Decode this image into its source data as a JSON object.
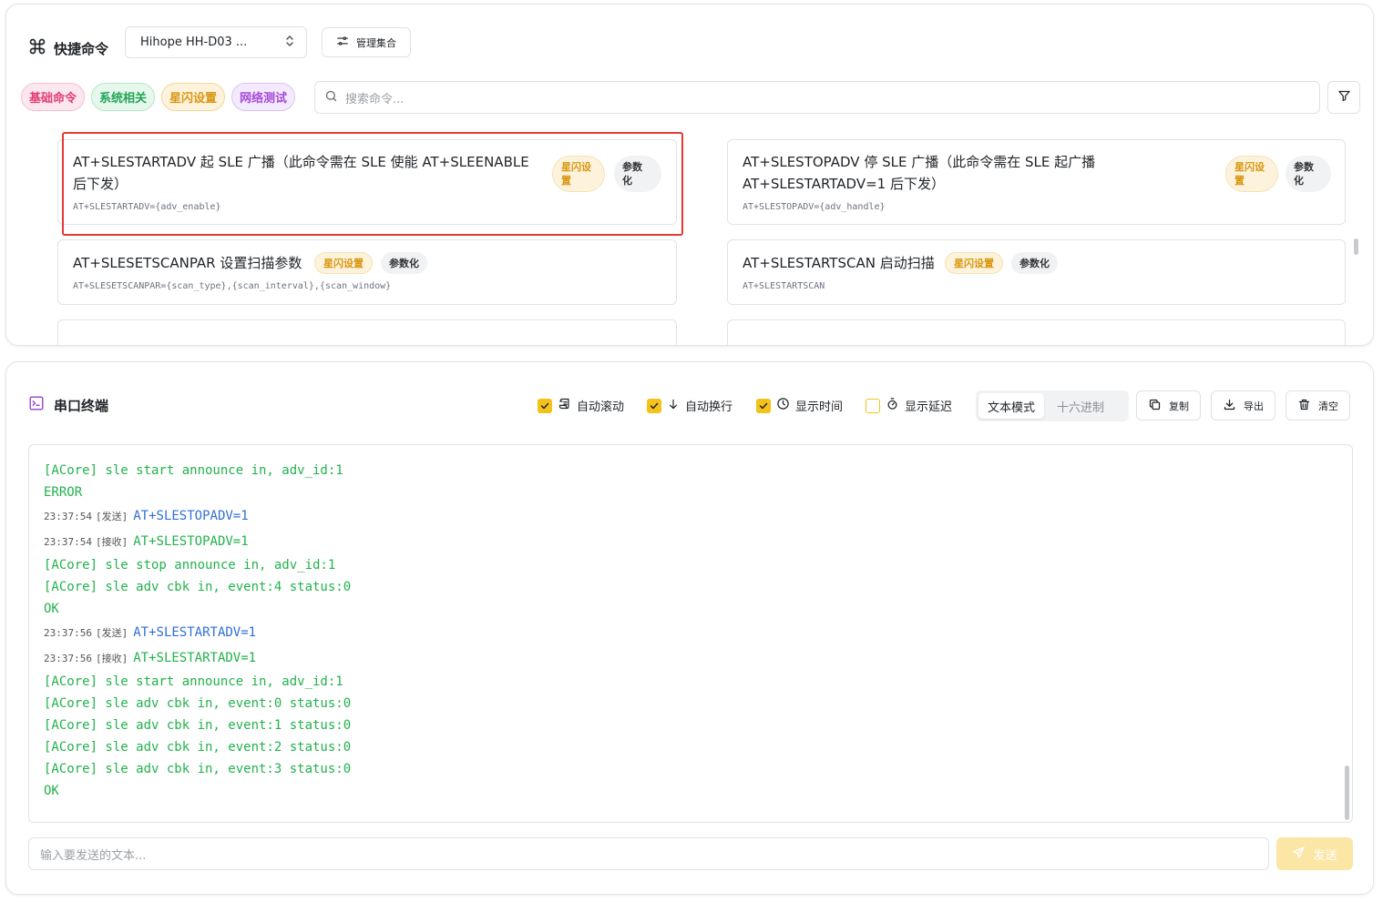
{
  "quick_commands": {
    "title": "快捷命令",
    "device_select": "Hihope HH-D03 ...",
    "manage_label": "管理集合",
    "tags": [
      "基础命令",
      "系统相关",
      "星闪设置",
      "网络测试"
    ],
    "search_placeholder": "搜索命令...",
    "cards": [
      {
        "name_line1": "AT+SLESTARTADV 起 SLE 广播（此命令需在 SLE 使能 AT+SLEENABLE",
        "name_line2": "后下发）",
        "command": "AT+SLESTARTADV={adv_enable}",
        "badge_category_line1": "星闪设",
        "badge_category_line2": "置",
        "badge_param_line1": "参数",
        "badge_param_line2": "化"
      },
      {
        "name_line1": "AT+SLESTOPADV 停 SLE 广播（此命令需在 SLE 起广播",
        "name_line2": "AT+SLESTARTADV=1 后下发）",
        "command": "AT+SLESTOPADV={adv_handle}",
        "badge_category_line1": "星闪设",
        "badge_category_line2": "置",
        "badge_param_line1": "参数",
        "badge_param_line2": "化"
      },
      {
        "name": "AT+SLESETSCANPAR 设置扫描参数",
        "command": "AT+SLESETSCANPAR={scan_type},{scan_interval},{scan_window}",
        "badge_category": "星闪设置",
        "badge_param": "参数化"
      },
      {
        "name": "AT+SLESTARTSCAN 启动扫描",
        "command": "AT+SLESTARTSCAN",
        "badge_category": "星闪设置",
        "badge_param": "参数化"
      }
    ]
  },
  "terminal": {
    "title": "串口终端",
    "options": {
      "auto_scroll": "自动滚动",
      "auto_wrap": "自动换行",
      "show_time": "显示时间",
      "show_delay": "显示延迟"
    },
    "modes": [
      "文本模式",
      "十六进制"
    ],
    "copy_label": "复制",
    "export_label": "导出",
    "clear_label": "清空",
    "log": [
      {
        "type": "plain",
        "text": "[ACore] sle start announce in, adv_id:1"
      },
      {
        "type": "plain",
        "text": "ERROR"
      },
      {
        "type": "meta",
        "time": "23:37:54",
        "dir": "[发送]",
        "kind": "sent",
        "text": "AT+SLESTOPADV=1"
      },
      {
        "type": "meta",
        "time": "23:37:54",
        "dir": "[接收]",
        "kind": "recv",
        "text": "AT+SLESTOPADV=1"
      },
      {
        "type": "plain",
        "text": "[ACore] sle stop announce in, adv_id:1"
      },
      {
        "type": "plain",
        "text": "[ACore] sle adv cbk in, event:4 status:0"
      },
      {
        "type": "plain",
        "text": "OK"
      },
      {
        "type": "meta",
        "time": "23:37:56",
        "dir": "[发送]",
        "kind": "sent",
        "text": "AT+SLESTARTADV=1"
      },
      {
        "type": "meta",
        "time": "23:37:56",
        "dir": "[接收]",
        "kind": "recv",
        "text": "AT+SLESTARTADV=1"
      },
      {
        "type": "plain",
        "text": "[ACore] sle start announce in, adv_id:1"
      },
      {
        "type": "plain",
        "text": "[ACore] sle adv cbk in, event:0 status:0"
      },
      {
        "type": "plain",
        "text": "[ACore] sle adv cbk in, event:1 status:0"
      },
      {
        "type": "plain",
        "text": "[ACore] sle adv cbk in, event:2 status:0"
      },
      {
        "type": "plain",
        "text": "[ACore] sle adv cbk in, event:3 status:0"
      },
      {
        "type": "plain",
        "text": "OK"
      }
    ],
    "input_placeholder": "输入要发送的文本...",
    "send_label": "发送"
  },
  "colors": {
    "accent": "#f4c21a",
    "highlight": "#e53935",
    "log_green": "#22b24c",
    "log_blue": "#2f6fd6"
  }
}
